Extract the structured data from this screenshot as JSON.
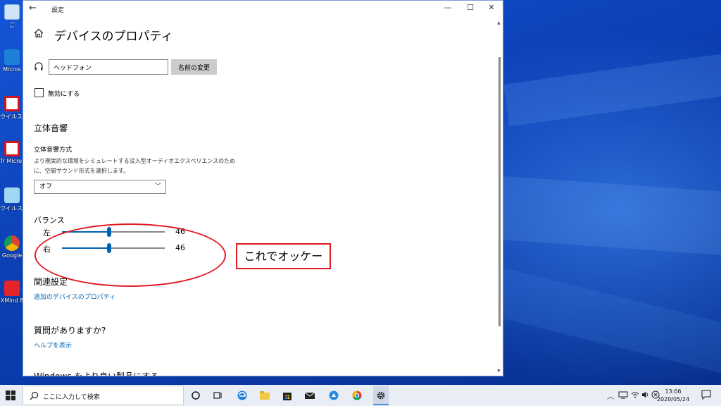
{
  "window": {
    "title": "設定",
    "back_glyph": "←",
    "minimize_glyph": "—",
    "maximize_glyph": "☐",
    "close_glyph": "✕"
  },
  "page": {
    "title": "デバイスのプロパティ"
  },
  "device": {
    "name_value": "ヘッドフォン",
    "rename_label": "名前の変更",
    "disable_label": "無効にする"
  },
  "spatial": {
    "heading": "立体音響",
    "format_label": "立体音響方式",
    "description": "より現実的な環境をシミュレートする没入型オーディオエクスペリエンスのために、空間サウンド形式を選択します。",
    "selected": "オフ",
    "chevron": "﹀"
  },
  "balance": {
    "heading": "バランス",
    "left_label": "左",
    "right_label": "右",
    "left_value": "46",
    "right_value": "46",
    "max": 100
  },
  "related": {
    "heading": "関連設定",
    "link": "追加のデバイスのプロパティ"
  },
  "help": {
    "heading": "質問がありますか?",
    "link": "ヘルプを表示"
  },
  "next_section": {
    "heading": "Windows をより良い製品にする"
  },
  "annotation": {
    "callout": "これでオッケー",
    "color": "#e01b24"
  },
  "desktop": {
    "icons": [
      {
        "label": "ご"
      },
      {
        "label": "Micros"
      },
      {
        "label": "ウイルスバ"
      },
      {
        "label": "Tr Micro_H"
      },
      {
        "label": "ウイルスバ 保護"
      },
      {
        "label": "Google"
      },
      {
        "label": "XMind 8"
      }
    ]
  },
  "taskbar": {
    "search_placeholder": "ここに入力して検索",
    "tray_chevron": "︿",
    "time": "13:06",
    "date": "2020/05/24"
  },
  "colors": {
    "accent": "#0063b1",
    "window_bg": "#ffffff",
    "taskbar_bg": "#e9eef6"
  }
}
